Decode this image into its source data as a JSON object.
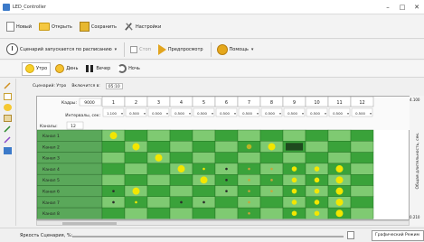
{
  "window": {
    "title": "LED_Controller",
    "minimize": "–",
    "maximize": "□",
    "close": "✕"
  },
  "toolbar_main": {
    "new_label": "Новый",
    "open_label": "Открыть",
    "save_label": "Сохранить",
    "settings_label": "Настройки"
  },
  "toolbar_secondary": {
    "schedule_label": "Сценарий запускается по расписанию",
    "stop_label": "Стоп",
    "preview_label": "Предпросмотр",
    "help_label": "Помощь"
  },
  "scene_tabs": [
    {
      "label": "Утро"
    },
    {
      "label": "День"
    },
    {
      "label": "Вечер"
    },
    {
      "label": "Ночь"
    }
  ],
  "scenario": {
    "label": "Сценарий: Утро",
    "start_label": "Включится в:",
    "start_time": "05:10"
  },
  "grid": {
    "frames_label": "Кадры:",
    "frames_value": "9000",
    "intervals_label": "Интервалы, сек:",
    "channels_label": "Каналы:",
    "channels_value": "12",
    "columns": [
      "1",
      "2",
      "3",
      "4",
      "5",
      "6",
      "7",
      "8",
      "9",
      "10",
      "11",
      "12"
    ],
    "interval_values": [
      "1.100",
      "0.500",
      "0.500",
      "0.500",
      "0.500",
      "0.500",
      "0.500",
      "0.500",
      "0.500",
      "0.500",
      "0.500",
      "0.500"
    ],
    "rows": [
      "Канал 1",
      "Канал 2",
      "Канал 3",
      "Канал 4",
      "Канал 5",
      "Канал 6",
      "Канал 7",
      "Канал 8"
    ]
  },
  "markers": [
    {
      "row": 0,
      "col": 0,
      "size": "large",
      "color": "#f2e600"
    },
    {
      "row": 1,
      "col": 1,
      "size": "large",
      "color": "#f2e600"
    },
    {
      "row": 1,
      "col": 6,
      "size": "medium",
      "color": "#b9b424"
    },
    {
      "row": 1,
      "col": 7,
      "size": "large",
      "color": "#f2e600"
    },
    {
      "row": 2,
      "col": 2,
      "size": "large",
      "color": "#f2e600"
    },
    {
      "row": 3,
      "col": 3,
      "size": "large",
      "color": "#f2e600"
    },
    {
      "row": 3,
      "col": 4,
      "size": "small",
      "color": "#f2e600"
    },
    {
      "row": 3,
      "col": 5,
      "size": "small",
      "color": "#2a2a2a"
    },
    {
      "row": 3,
      "col": 6,
      "size": "small",
      "color": "#c9a43a"
    },
    {
      "row": 3,
      "col": 7,
      "size": "small",
      "color": "#c9a43a"
    },
    {
      "row": 3,
      "col": 8,
      "size": "medium",
      "color": "#f2e600"
    },
    {
      "row": 3,
      "col": 9,
      "size": "medium",
      "color": "#f2e600"
    },
    {
      "row": 3,
      "col": 10,
      "size": "large",
      "color": "#f2e600"
    },
    {
      "row": 4,
      "col": 4,
      "size": "large",
      "color": "#f2e600"
    },
    {
      "row": 4,
      "col": 5,
      "size": "small",
      "color": "#2a2a2a"
    },
    {
      "row": 4,
      "col": 6,
      "size": "small",
      "color": "#c9a43a"
    },
    {
      "row": 4,
      "col": 7,
      "size": "small",
      "color": "#c9a43a"
    },
    {
      "row": 4,
      "col": 8,
      "size": "medium",
      "color": "#f2e600"
    },
    {
      "row": 4,
      "col": 9,
      "size": "medium",
      "color": "#f2e600"
    },
    {
      "row": 4,
      "col": 10,
      "size": "large",
      "color": "#f2e600"
    },
    {
      "row": 5,
      "col": 0,
      "size": "small",
      "color": "#2a2a2a"
    },
    {
      "row": 5,
      "col": 1,
      "size": "large",
      "color": "#f2e600"
    },
    {
      "row": 5,
      "col": 5,
      "size": "small",
      "color": "#2a2a2a"
    },
    {
      "row": 5,
      "col": 6,
      "size": "small",
      "color": "#c9a43a"
    },
    {
      "row": 5,
      "col": 7,
      "size": "small",
      "color": "#c9a43a"
    },
    {
      "row": 5,
      "col": 8,
      "size": "medium",
      "color": "#f2e600"
    },
    {
      "row": 5,
      "col": 9,
      "size": "medium",
      "color": "#f2e600"
    },
    {
      "row": 5,
      "col": 10,
      "size": "large",
      "color": "#f2e600"
    },
    {
      "row": 6,
      "col": 0,
      "size": "small",
      "color": "#2a2a2a"
    },
    {
      "row": 6,
      "col": 1,
      "size": "small",
      "color": "#f2e600"
    },
    {
      "row": 6,
      "col": 3,
      "size": "small",
      "color": "#2a2a2a"
    },
    {
      "row": 6,
      "col": 4,
      "size": "small",
      "color": "#2a2a2a"
    },
    {
      "row": 6,
      "col": 6,
      "size": "small",
      "color": "#c9a43a"
    },
    {
      "row": 6,
      "col": 8,
      "size": "medium",
      "color": "#f2e600"
    },
    {
      "row": 6,
      "col": 9,
      "size": "medium",
      "color": "#f2e600"
    },
    {
      "row": 6,
      "col": 10,
      "size": "large",
      "color": "#f2e600"
    },
    {
      "row": 7,
      "col": 6,
      "size": "small",
      "color": "#c9a43a"
    },
    {
      "row": 7,
      "col": 8,
      "size": "medium",
      "color": "#f2e600"
    },
    {
      "row": 7,
      "col": 9,
      "size": "medium",
      "color": "#f2e600"
    },
    {
      "row": 7,
      "col": 10,
      "size": "large",
      "color": "#f2e600"
    }
  ],
  "dark_blocks": [
    {
      "row": 1,
      "col": 8,
      "color": "#1e4a1e"
    }
  ],
  "right_axis": {
    "label": "Общая длительность, сек.",
    "top_value": "4.100",
    "bottom_value": "0.210"
  },
  "bottom": {
    "brightness_label": "Яркость Сценария, %:",
    "graphic_button": "Графический Режим"
  },
  "colors": {
    "grid_row_light": "#7fca72",
    "grid_row_dark": "#3aa23a",
    "grid_dot_yellow": "#f2e600",
    "row_label_bg": "#5aa85a"
  }
}
